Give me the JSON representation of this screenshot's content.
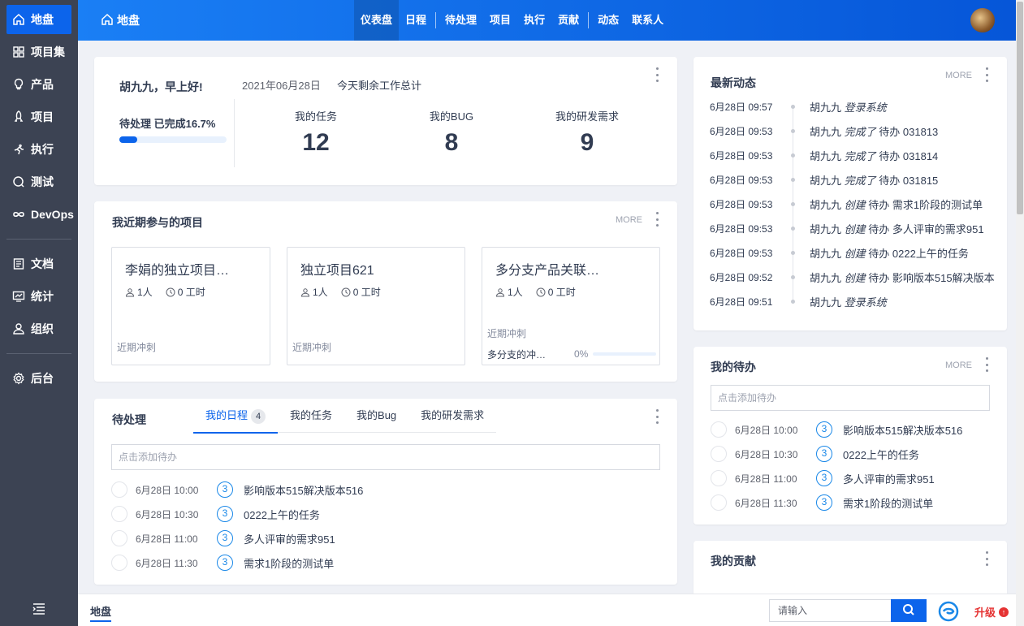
{
  "sidebar": {
    "items": [
      {
        "label": "地盘",
        "icon": "home-icon",
        "active": true
      },
      {
        "label": "项目集",
        "icon": "grid-icon"
      },
      {
        "label": "产品",
        "icon": "bulb-icon"
      },
      {
        "label": "项目",
        "icon": "rocket-icon"
      },
      {
        "label": "执行",
        "icon": "run-icon"
      },
      {
        "label": "测试",
        "icon": "test-icon"
      },
      {
        "label": "DevOps",
        "icon": "infinity-icon"
      },
      {
        "label": "文档",
        "icon": "doc-icon"
      },
      {
        "label": "统计",
        "icon": "monitor-icon"
      },
      {
        "label": "组织",
        "icon": "people-icon"
      },
      {
        "label": "后台",
        "icon": "gear-icon"
      }
    ]
  },
  "topbar": {
    "title": "地盘",
    "nav": [
      "仪表盘",
      "日程",
      "待处理",
      "项目",
      "执行",
      "贡献",
      "动态",
      "联系人"
    ]
  },
  "welcome": {
    "greeting": "胡九九，早上好!",
    "date": "2021年06月28日",
    "summary": "今天剩余工作总计",
    "progress_label": "待处理 已完成16.7%",
    "progress": 16.7,
    "stats": [
      {
        "label": "我的任务",
        "value": "12"
      },
      {
        "label": "我的BUG",
        "value": "8"
      },
      {
        "label": "我的研发需求",
        "value": "9"
      }
    ]
  },
  "projects": {
    "title": "我近期参与的项目",
    "more": "MORE",
    "items": [
      {
        "name": "李娟的独立项目…",
        "members": "1人",
        "hours": "0 工时",
        "sprint": "近期冲刺"
      },
      {
        "name": "独立项目621",
        "members": "1人",
        "hours": "0 工时",
        "sprint": "近期冲刺"
      },
      {
        "name": "多分支产品关联…",
        "members": "1人",
        "hours": "0 工时",
        "sprint": "近期冲刺",
        "sprint_name": "多分支的冲…",
        "sprint_progress": "0%"
      }
    ]
  },
  "pending": {
    "title": "待处理",
    "tabs": [
      "我的日程",
      "我的任务",
      "我的Bug",
      "我的研发需求"
    ],
    "tab_badge": "4",
    "placeholder": "点击添加待办",
    "rows": [
      {
        "time": "6月28日 10:00",
        "pri": "3",
        "name": "影响版本515解决版本516"
      },
      {
        "time": "6月28日 10:30",
        "pri": "3",
        "name": "0222上午的任务"
      },
      {
        "time": "6月28日 11:00",
        "pri": "3",
        "name": "多人评审的需求951"
      },
      {
        "time": "6月28日 11:30",
        "pri": "3",
        "name": "需求1阶段的测试单"
      }
    ]
  },
  "activity": {
    "title": "最新动态",
    "more": "MORE",
    "rows": [
      {
        "time": "6月28日 09:57",
        "user": "胡九九",
        "action": "登录系统",
        "object": ""
      },
      {
        "time": "6月28日 09:53",
        "user": "胡九九",
        "action": "完成了",
        "object": "待办 031813"
      },
      {
        "time": "6月28日 09:53",
        "user": "胡九九",
        "action": "完成了",
        "object": "待办 031814"
      },
      {
        "time": "6月28日 09:53",
        "user": "胡九九",
        "action": "完成了",
        "object": "待办 031815"
      },
      {
        "time": "6月28日 09:53",
        "user": "胡九九",
        "action": "创建",
        "object": "待办 需求1阶段的测试单"
      },
      {
        "time": "6月28日 09:53",
        "user": "胡九九",
        "action": "创建",
        "object": "待办 多人评审的需求951"
      },
      {
        "time": "6月28日 09:53",
        "user": "胡九九",
        "action": "创建",
        "object": "待办 0222上午的任务"
      },
      {
        "time": "6月28日 09:52",
        "user": "胡九九",
        "action": "创建",
        "object": "待办 影响版本515解决版本"
      },
      {
        "time": "6月28日 09:51",
        "user": "胡九九",
        "action": "登录系统",
        "object": ""
      }
    ]
  },
  "mytodo": {
    "title": "我的待办",
    "more": "MORE",
    "placeholder": "点击添加待办",
    "rows": [
      {
        "time": "6月28日 10:00",
        "pri": "3",
        "name": "影响版本515解决版本516"
      },
      {
        "time": "6月28日 10:30",
        "pri": "3",
        "name": "0222上午的任务"
      },
      {
        "time": "6月28日 11:00",
        "pri": "3",
        "name": "多人评审的需求951"
      },
      {
        "time": "6月28日 11:30",
        "pri": "3",
        "name": "需求1阶段的测试单"
      }
    ]
  },
  "contribution": {
    "title": "我的贡献"
  },
  "bottombar": {
    "title": "地盘",
    "search_placeholder": "请输入",
    "upgrade": "升级"
  },
  "colors": {
    "primary": "#0c64eb",
    "sidebar": "#3c4353",
    "danger": "#e53333"
  }
}
